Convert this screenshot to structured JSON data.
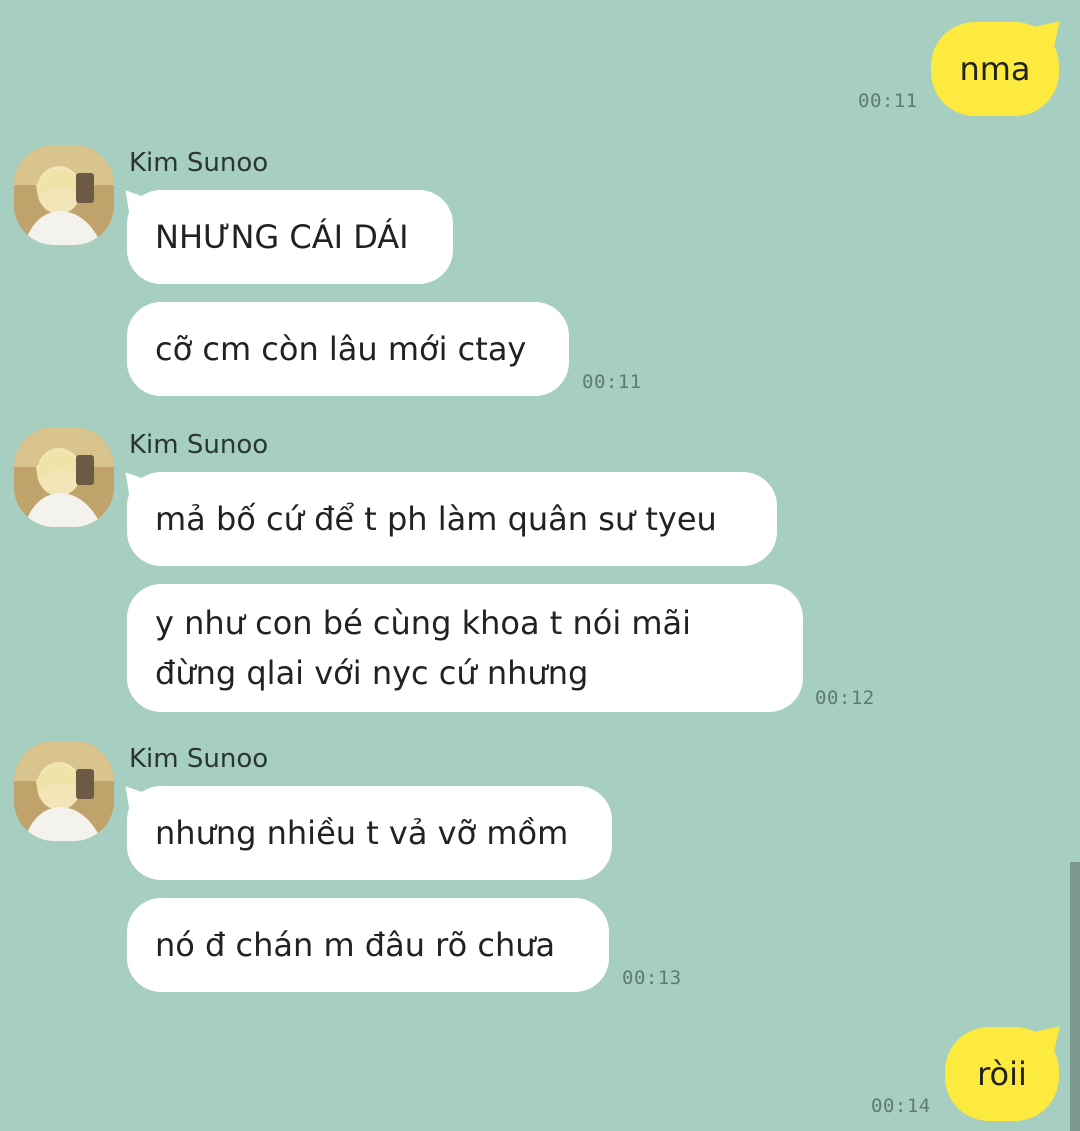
{
  "conversation": {
    "contact_name": "Kim Sunoo",
    "messages": [
      {
        "id": "m1",
        "direction": "outgoing",
        "text": "nma",
        "time": "00:11"
      },
      {
        "id": "g1",
        "direction": "incoming",
        "sender": "Kim Sunoo",
        "bubbles": [
          "NHƯNG CÁI DÁI",
          "cỡ cm còn lâu mới ctay"
        ],
        "time": "00:11"
      },
      {
        "id": "g2",
        "direction": "incoming",
        "sender": "Kim Sunoo",
        "bubbles": [
          "mả bố cứ để t ph làm quân sư tyeu",
          "y như con bé cùng khoa t nói mãi\nđừng qlai với nyc cứ nhưng"
        ],
        "time": "00:12"
      },
      {
        "id": "g3",
        "direction": "incoming",
        "sender": "Kim Sunoo",
        "bubbles": [
          "nhưng nhiều t vả vỡ mồm",
          "nó đ chán m đâu rõ chưa"
        ],
        "time": "00:13"
      },
      {
        "id": "m2",
        "direction": "outgoing",
        "text": "ròii",
        "time": "00:14"
      }
    ]
  },
  "ui": {
    "theme_background": "#a6cfc2",
    "outgoing_bubble_color": "#fdea3f",
    "incoming_bubble_color": "#ffffff",
    "avatar_icon": "avatar-photo-icon"
  }
}
